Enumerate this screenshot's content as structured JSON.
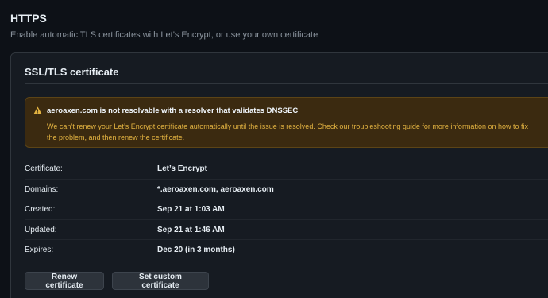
{
  "header": {
    "title": "HTTPS",
    "subtitle": "Enable automatic TLS certificates with Let’s Encrypt, or use your own certificate"
  },
  "card": {
    "title": "SSL/TLS certificate"
  },
  "warning": {
    "icon": "warning-triangle-icon",
    "title": "aeroaxen.com is not resolvable with a resolver that validates DNSSEC",
    "body_before": "We can’t renew your Let’s Encrypt certificate automatically until the issue is resolved. Check our ",
    "link": "troubleshooting guide",
    "body_after": " for more information on how to fix the problem, and then renew the certificate.",
    "background": "#3b2a10",
    "text_color": "#e3b341"
  },
  "details": [
    {
      "label": "Certificate:",
      "value": "Let’s Encrypt"
    },
    {
      "label": "Domains:",
      "value": "*.aeroaxen.com, aeroaxen.com"
    },
    {
      "label": "Created:",
      "value": "Sep 21 at 1:03 AM"
    },
    {
      "label": "Updated:",
      "value": "Sep 21 at 1:46 AM"
    },
    {
      "label": "Expires:",
      "value": "Dec 20 (in 3 months)"
    }
  ],
  "buttons": {
    "renew": "Renew certificate",
    "custom": "Set custom certificate"
  }
}
